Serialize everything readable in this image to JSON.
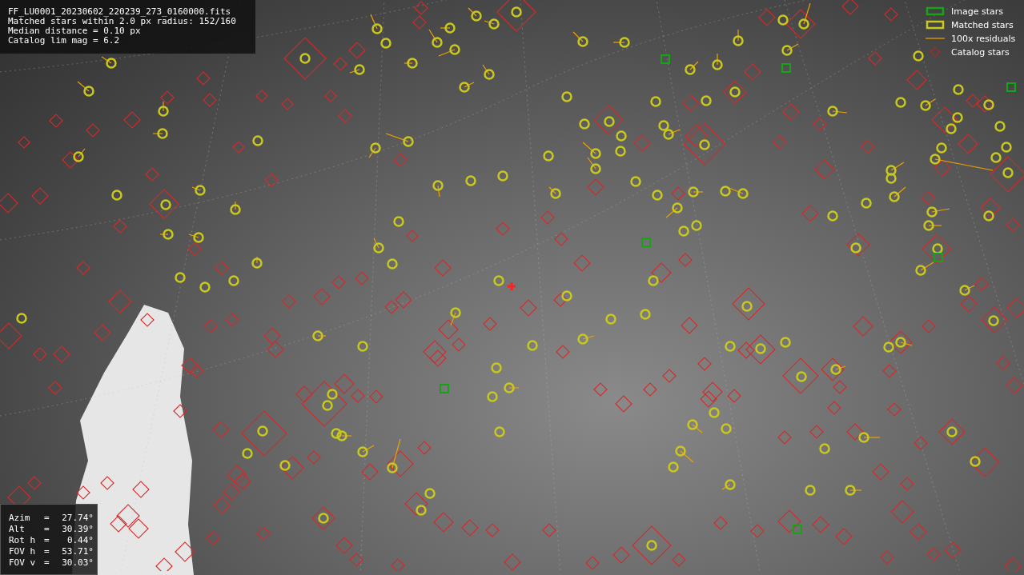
{
  "header_lines": [
    "FF_LU0001_20230602_220239_273_0160000.fits",
    "Matched stars within 2.0 px radius: 152/160",
    "Median distance = 0.10 px",
    "Catalog lim mag = 6.2"
  ],
  "legend": [
    {
      "kind": "image",
      "label": "Image stars"
    },
    {
      "kind": "matched",
      "label": "Matched stars"
    },
    {
      "kind": "residual",
      "label": "100x residuals"
    },
    {
      "kind": "catalog",
      "label": "Catalog stars"
    }
  ],
  "pointing": [
    {
      "label": "Azim",
      "sep": "=",
      "value": "27.74°"
    },
    {
      "label": "Alt",
      "sep": "=",
      "value": "30.39°"
    },
    {
      "label": "Rot h",
      "sep": "=",
      "value": "0.44°"
    },
    {
      "label": "FOV h",
      "sep": "=",
      "value": "53.71°"
    },
    {
      "label": "FOV v",
      "sep": "=",
      "value": "30.03°"
    }
  ]
}
